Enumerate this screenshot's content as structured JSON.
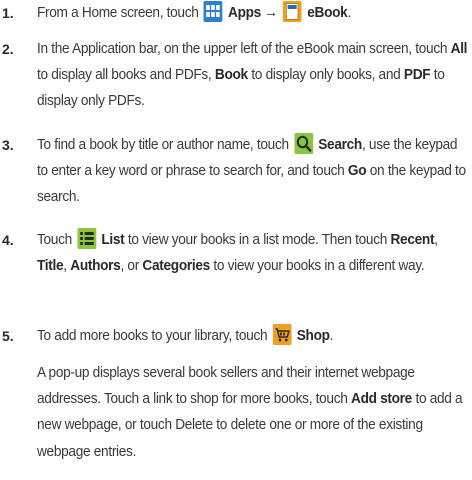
{
  "steps": [
    {
      "num": "1.",
      "t1": "From a Home screen, touch",
      "b1": "Apps",
      "arrow": "→",
      "b2": "eBook",
      "t2": "."
    },
    {
      "num": "2.",
      "t1": "In the Application bar, on the upper left of the eBook main screen, touch",
      "b1": "All",
      "t2": "to display all books and PDFs,",
      "b2": "Book",
      "t3": "to display only books, and",
      "b3": "PDF",
      "t4": "to display only PDFs."
    },
    {
      "num": "3.",
      "t1": "To find a book by title or author name, touch",
      "b1": "Search",
      "t2": ", use the keypad to enter a key word or phrase to search for, and touch",
      "b2": "Go",
      "t3": "on the keypad to search."
    },
    {
      "num": "4.",
      "t1": "Touch",
      "b1": "List",
      "t2": "to view your books in a list mode. Then touch",
      "b2": "Recent",
      "t3": ",",
      "b3": "Title",
      "t4": ",",
      "b4": "Authors",
      "t5": ", or",
      "b5": "Categories",
      "t6": "to view your books in a different way."
    },
    {
      "num": "5.",
      "t1": "To add more books to your library, touch",
      "b1": "Shop",
      "t2": ".",
      "p1": "A pop-up displays several book sellers and their internet webpage addresses. Touch a link to shop for more books, touch",
      "pb1": "Add store",
      "p2": "to add a new webpage, or touch Delete to delete one or more of the existing webpage entries."
    }
  ],
  "icons": {
    "apps": "apps-grid-icon",
    "ebook": "ebook-icon",
    "search": "search-icon",
    "list": "list-icon",
    "shop": "shop-cart-icon"
  },
  "colors": {
    "icon_blue": "#2f7fd0",
    "icon_green": "#8cc63f",
    "icon_orange": "#f0a020"
  }
}
